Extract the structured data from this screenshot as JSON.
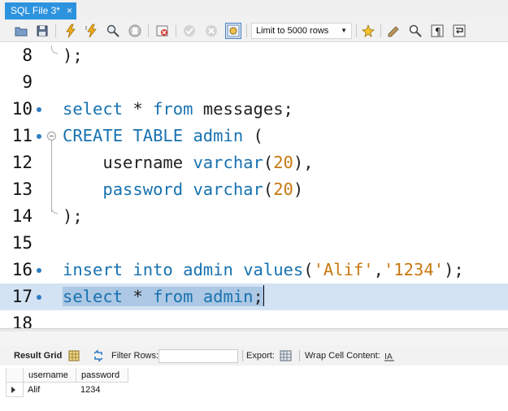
{
  "tab": {
    "title": "SQL File 3*",
    "close_glyph": "×"
  },
  "toolbar": {
    "buttons": [
      "open-folder-icon",
      "save-icon",
      "execute-icon",
      "execute-current-icon",
      "explain-icon",
      "stop-icon",
      "toggle-error-icon",
      "commit-icon",
      "rollback-icon",
      "autocommit-icon",
      "beautify-icon",
      "find-icon",
      "invisible-chars-icon",
      "wrap-icon",
      "bookmark-icon"
    ],
    "limit_label": "Limit to 5000 rows"
  },
  "editor": {
    "lines": [
      {
        "num": "8",
        "text": ");"
      },
      {
        "num": "9",
        "text": ""
      },
      {
        "num": "10",
        "text": "select * from messages;"
      },
      {
        "num": "11",
        "text": "CREATE TABLE admin ("
      },
      {
        "num": "12",
        "text": "username varchar(20),"
      },
      {
        "num": "13",
        "text": "password varchar(20)"
      },
      {
        "num": "14",
        "text": ");"
      },
      {
        "num": "15",
        "text": ""
      },
      {
        "num": "16",
        "text": "insert into admin values('Alif','1234');"
      },
      {
        "num": "17",
        "text": "select * from admin;"
      },
      {
        "num": "18",
        "text": ""
      }
    ],
    "highlighted_line": "17",
    "colors": {
      "keyword": "#1772b0",
      "number": "#c8780f",
      "string": "#c8780f",
      "selection": "#adc8e4",
      "line_highlight": "#d3e3f3"
    }
  },
  "result": {
    "tab_label": "Result Grid",
    "filter_label": "Filter Rows:",
    "filter_value": "",
    "export_label": "Export:",
    "wrap_label": "Wrap Cell Content:",
    "columns": [
      "username",
      "password"
    ],
    "rows": [
      [
        "Alif",
        "1234"
      ]
    ]
  }
}
